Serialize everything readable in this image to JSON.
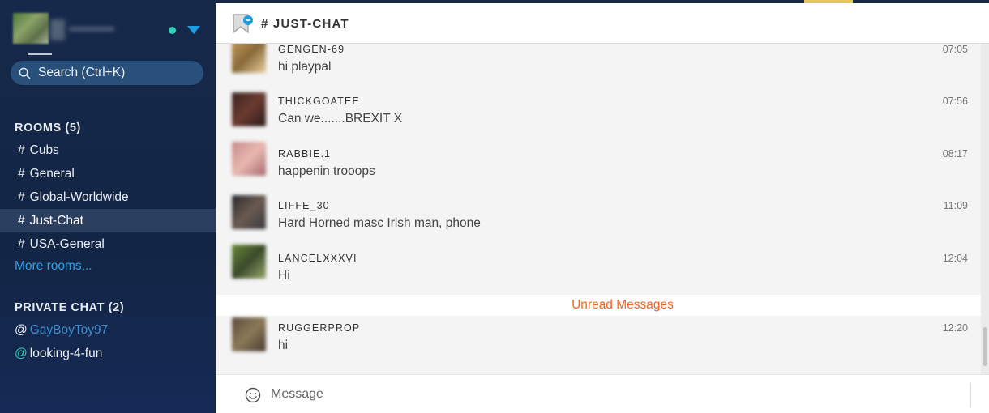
{
  "user": {
    "name": "••••••••••"
  },
  "search": {
    "label": "Search (Ctrl+K)"
  },
  "rooms": {
    "title": "ROOMS (5)",
    "items": [
      {
        "label": "Cubs"
      },
      {
        "label": "General"
      },
      {
        "label": "Global-Worldwide"
      },
      {
        "label": "Just-Chat"
      },
      {
        "label": "USA-General"
      }
    ],
    "more_label": "More rooms..."
  },
  "private_chat": {
    "title": "PRIVATE CHAT (2)",
    "items": [
      {
        "prefix": "@",
        "name": "GayBoyToy97"
      },
      {
        "prefix": "@",
        "name": "looking-4-fun"
      }
    ]
  },
  "chat": {
    "title": "# JUST-CHAT",
    "messages": [
      {
        "author": "GENGEN-69",
        "time": "07:05",
        "text": "hi playpal"
      },
      {
        "author": "THICKGOATEE",
        "time": "07:56",
        "text": "Can we.......BREXIT X"
      },
      {
        "author": "RABBIE.1",
        "time": "08:17",
        "text": "happenin trooops"
      },
      {
        "author": "LIFFE_30",
        "time": "11:09",
        "text": "Hard Horned masc Irish man, phone"
      },
      {
        "author": "LANCELXXXVI",
        "time": "12:04",
        "text": "Hi"
      },
      {
        "author": "RUGGERPROP",
        "time": "12:20",
        "text": "hi"
      }
    ],
    "unread_label": "Unread Messages"
  },
  "composer": {
    "placeholder": "Message"
  },
  "icons": [
    "search-icon",
    "caret-down-icon",
    "room-flag-icon",
    "emoji-icon"
  ],
  "colors": {
    "sidebar_bg": "#17294a",
    "accent_blue": "#2da0e6",
    "online_green": "#2ed3b7",
    "unread_orange": "#f26322"
  }
}
